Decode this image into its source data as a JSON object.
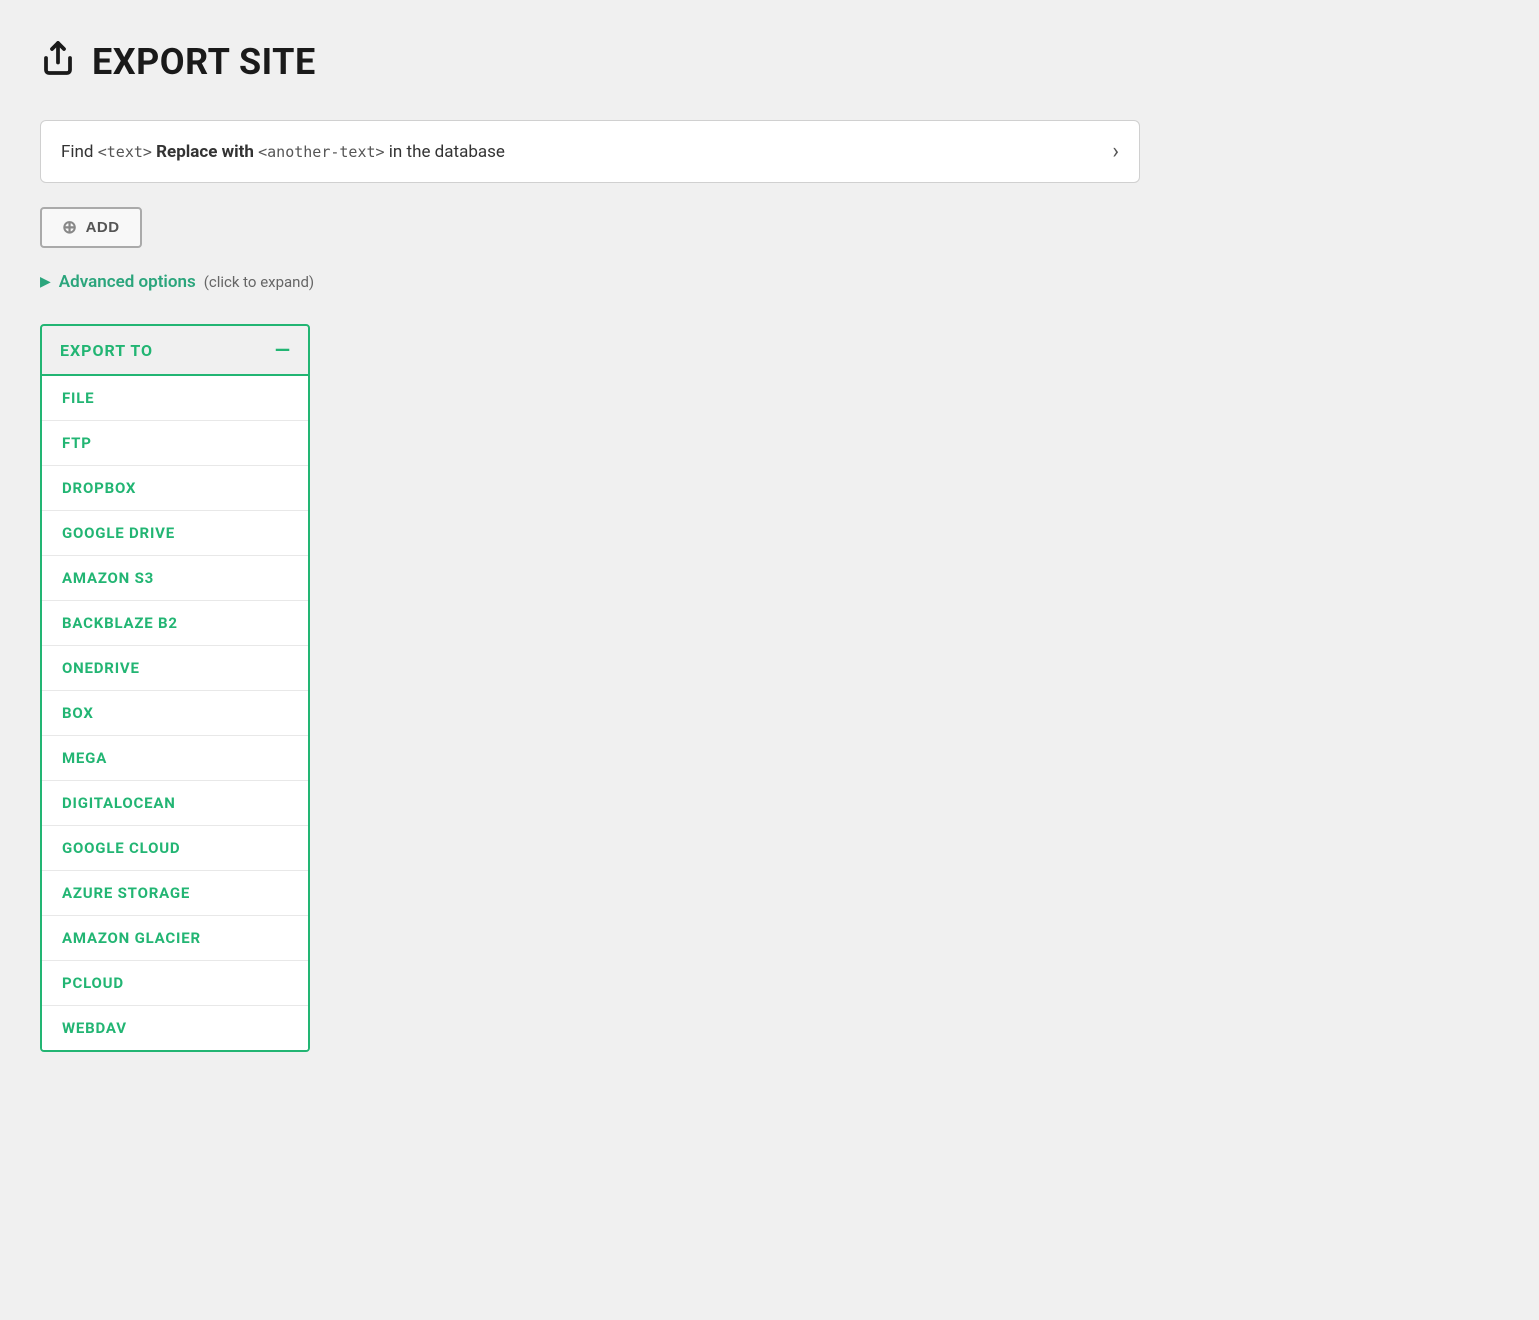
{
  "page": {
    "title": "EXPORT SITE",
    "icon": "export-icon"
  },
  "find_replace": {
    "label_prefix": "Find",
    "code1": "<text>",
    "bold1": "Replace with",
    "code2": "<another-text>",
    "label_suffix": "in the database"
  },
  "add_button": {
    "label": "ADD",
    "plus_symbol": "⊕"
  },
  "advanced_options": {
    "label": "Advanced options",
    "hint": "(click to expand)",
    "arrow": "▶"
  },
  "export_to": {
    "title": "EXPORT TO",
    "collapse_symbol": "—",
    "items": [
      {
        "label": "FILE"
      },
      {
        "label": "FTP"
      },
      {
        "label": "DROPBOX"
      },
      {
        "label": "GOOGLE DRIVE"
      },
      {
        "label": "AMAZON S3"
      },
      {
        "label": "BACKBLAZE B2"
      },
      {
        "label": "ONEDRIVE"
      },
      {
        "label": "BOX"
      },
      {
        "label": "MEGA"
      },
      {
        "label": "DIGITALOCEAN"
      },
      {
        "label": "GOOGLE CLOUD"
      },
      {
        "label": "AZURE STORAGE"
      },
      {
        "label": "AMAZON GLACIER"
      },
      {
        "label": "PCLOUD"
      },
      {
        "label": "WEBDAV"
      }
    ]
  }
}
